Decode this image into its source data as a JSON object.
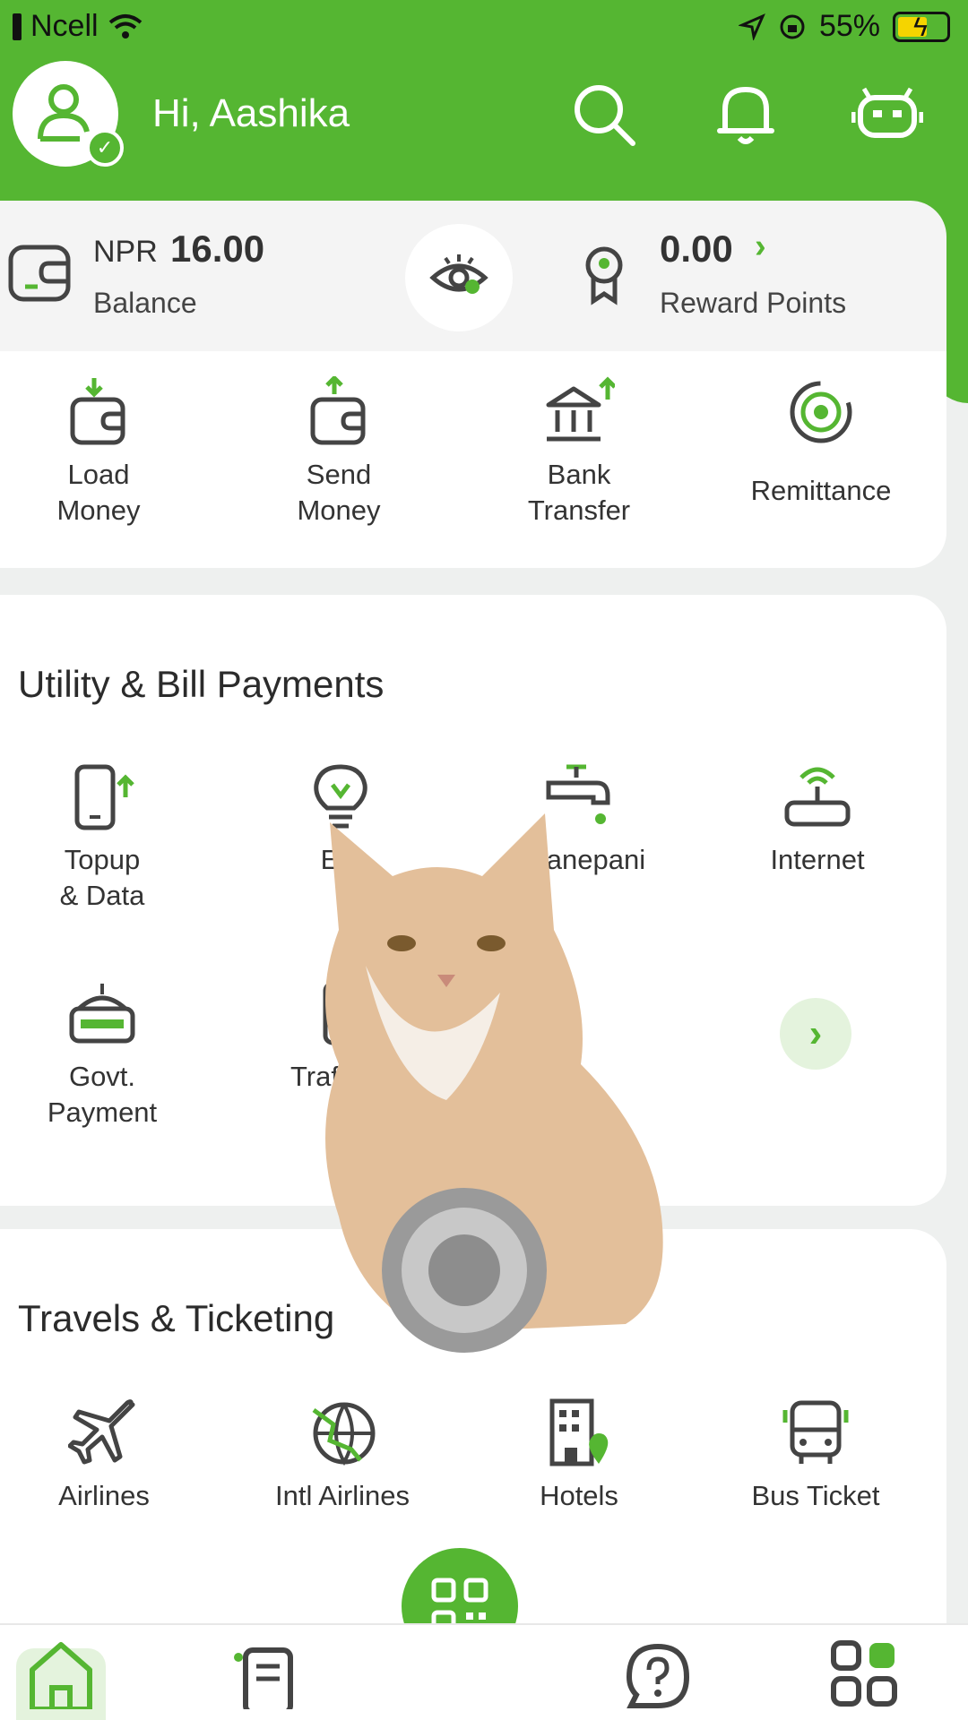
{
  "status_bar": {
    "carrier": "Ncell",
    "battery": "55%"
  },
  "header": {
    "greeting": "Hi, Aashika",
    "icons": [
      "user-avatar-icon",
      "search-icon",
      "bell-icon",
      "bot-icon"
    ]
  },
  "balance": {
    "currency": "NPR",
    "amount": "16.00",
    "label": "Balance",
    "reward_amount": "0.00",
    "reward_label": "Reward Points"
  },
  "quick_actions": [
    {
      "line1": "Load",
      "line2": "Money",
      "icon": "load-money-icon"
    },
    {
      "line1": "Send",
      "line2": "Money",
      "icon": "send-money-icon"
    },
    {
      "line1": "Bank",
      "line2": "Transfer",
      "icon": "bank-transfer-icon"
    },
    {
      "line1": "Remittance",
      "line2": "",
      "icon": "remittance-icon"
    }
  ],
  "utility": {
    "title": "Utility & Bill Payments",
    "items": [
      {
        "line1": "Topup",
        "line2": "& Data",
        "icon": "mobile-topup-icon"
      },
      {
        "line1": "Ele",
        "line2": "",
        "icon": "electricity-icon"
      },
      {
        "line1": "Khanepani",
        "line2": "",
        "icon": "water-tap-icon"
      },
      {
        "line1": "Internet",
        "line2": "",
        "icon": "router-icon"
      },
      {
        "line1": "Govt.",
        "line2": "Payment",
        "icon": "govt-payment-icon"
      },
      {
        "line1": "Traffic F",
        "line2": "",
        "icon": "traffic-icon"
      }
    ]
  },
  "travel": {
    "title": "Travels & Ticketing",
    "items": [
      {
        "label": "Airlines",
        "icon": "airplane-icon"
      },
      {
        "label": "Intl Airlines",
        "icon": "intl-airlines-icon"
      },
      {
        "label": "Hotels",
        "icon": "hotel-icon"
      },
      {
        "label": "Bus Ticket",
        "icon": "bus-icon"
      }
    ]
  },
  "bottom_nav": [
    "home-icon",
    "statement-icon",
    "qr-scan-icon",
    "help-icon",
    "apps-icon"
  ],
  "colors": {
    "brand_green": "#55b632",
    "light_green": "#e4f3dd"
  }
}
